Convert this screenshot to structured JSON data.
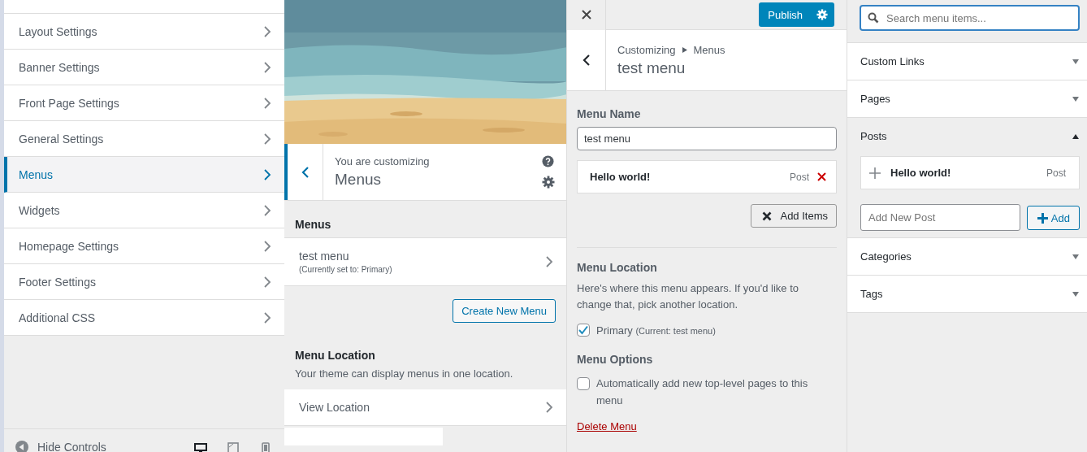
{
  "sections": [
    {
      "label": "Layout Settings",
      "selected": false
    },
    {
      "label": "Banner Settings",
      "selected": false
    },
    {
      "label": "Front Page Settings",
      "selected": false
    },
    {
      "label": "General Settings",
      "selected": false
    },
    {
      "label": "Menus",
      "selected": true
    },
    {
      "label": "Widgets",
      "selected": false
    },
    {
      "label": "Homepage Settings",
      "selected": false
    },
    {
      "label": "Footer Settings",
      "selected": false
    },
    {
      "label": "Additional CSS",
      "selected": false
    }
  ],
  "footer": {
    "hide_controls": "Hide Controls",
    "devices": [
      {
        "kind": "desktop",
        "selected": true
      },
      {
        "kind": "tablet",
        "selected": false
      },
      {
        "kind": "mobile",
        "selected": false
      }
    ]
  },
  "menus_panel": {
    "kicker": "You are customizing",
    "title": "Menus",
    "menus_heading": "Menus",
    "menus": [
      {
        "name": "test menu",
        "note": "(Currently set to: Primary)"
      }
    ],
    "create_button": "Create New Menu",
    "location_heading": "Menu Location",
    "location_text": "Your theme can display menus in one location.",
    "view_location": "View Location"
  },
  "menu_editor": {
    "publish": "Publish",
    "breadcrumb": [
      "Customizing",
      "Menus"
    ],
    "title": "test menu",
    "name_label": "Menu Name",
    "name_value": "test menu",
    "items": [
      {
        "title": "Hello world!",
        "type": "Post"
      }
    ],
    "add_items": "Add Items",
    "location_heading": "Menu Location",
    "location_text": "Here's where this menu appears. If you'd like to change that, pick another location.",
    "locations": [
      {
        "label": "Primary",
        "note": "(Current: test menu)",
        "checked": true
      }
    ],
    "options_heading": "Menu Options",
    "options": [
      {
        "label": "Automatically add new top-level pages to this menu",
        "checked": false
      }
    ],
    "delete": "Delete Menu"
  },
  "item_picker": {
    "search": {
      "placeholder": "Search menu items..."
    },
    "groups": [
      {
        "title": "Custom Links",
        "expanded": false
      },
      {
        "title": "Pages",
        "expanded": false
      },
      {
        "title": "Posts",
        "expanded": true,
        "items": [
          {
            "title": "Hello world!",
            "type": "Post"
          }
        ],
        "add_placeholder": "Add New Post",
        "add_button": "Add"
      },
      {
        "title": "Categories",
        "expanded": false
      },
      {
        "title": "Tags",
        "expanded": false
      }
    ]
  }
}
